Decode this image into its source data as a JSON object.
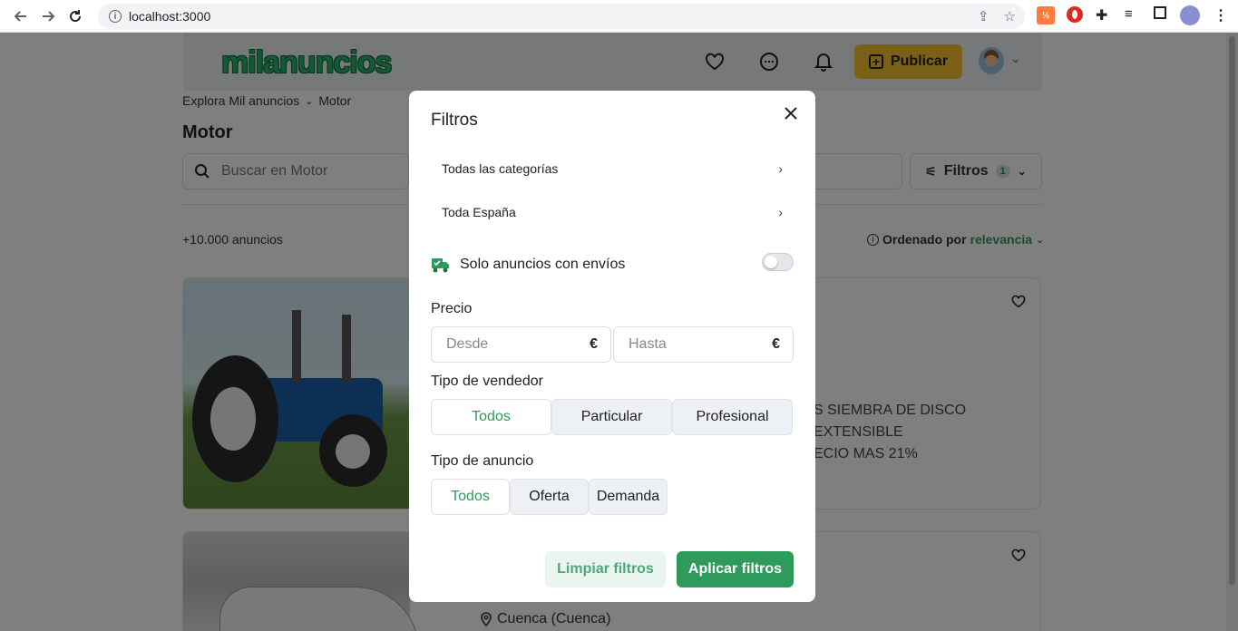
{
  "browser": {
    "url": "localhost:3000"
  },
  "header": {
    "logo": "milanuncios",
    "publish_label": "Publicar"
  },
  "breadcrumb": {
    "root": "Explora Mil anuncios",
    "current": "Motor"
  },
  "page": {
    "title": "Motor",
    "search_placeholder": "Buscar en Motor",
    "filters_label": "Filtros",
    "filters_count": "1",
    "results_count": "+10.000 anuncios",
    "sort_prefix": "Ordenado por",
    "sort_value": "relevancia"
  },
  "listings": [
    {
      "desc_line1": "S SIEMBRA DE DISCO EXTENSIBLE",
      "desc_line2": "ECIO MAS 21%"
    },
    {
      "location": "Cuenca (Cuenca)"
    }
  ],
  "modal": {
    "title": "Filtros",
    "category_label": "Todas las categorías",
    "location_label": "Toda España",
    "shipping_label": "Solo anuncios con envíos",
    "shipping_enabled": false,
    "price_label": "Precio",
    "price_from_placeholder": "Desde",
    "price_to_placeholder": "Hasta",
    "currency": "€",
    "seller_type_label": "Tipo de vendedor",
    "seller_options": [
      "Todos",
      "Particular",
      "Profesional"
    ],
    "seller_selected": "Todos",
    "ad_type_label": "Tipo de anuncio",
    "ad_type_options": [
      "Todos",
      "Oferta",
      "Demanda"
    ],
    "ad_type_selected": "Todos",
    "clear_label": "Limpiar filtros",
    "apply_label": "Aplicar filtros"
  },
  "colors": {
    "accent_green": "#2e9a5c",
    "publish_yellow": "#f6c22e"
  }
}
